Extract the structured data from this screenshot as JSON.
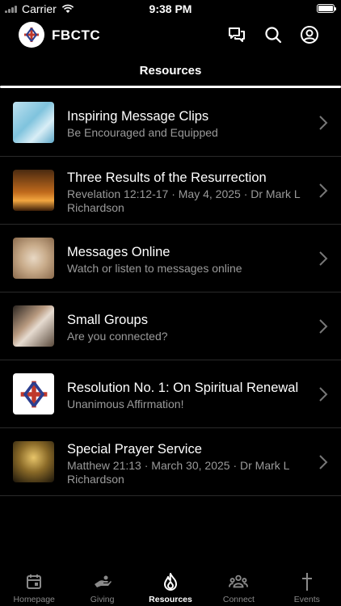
{
  "status_bar": {
    "carrier": "Carrier",
    "time": "9:38 PM"
  },
  "header": {
    "org_name": "FBCTC"
  },
  "section": {
    "title": "Resources"
  },
  "resources": [
    {
      "title": "Inspiring Message Clips",
      "subtitle": "Be Encouraged and Equipped",
      "thumb": "sky"
    },
    {
      "title": "Three Results of the Resurrection",
      "subtitle": "Revelation 12:12-17 · May 4, 2025 · Dr Mark L Richardson",
      "thumb": "resurrection"
    },
    {
      "title": "Messages Online",
      "subtitle": "Watch or listen to messages online",
      "thumb": "online"
    },
    {
      "title": "Small Groups",
      "subtitle": "Are you connected?",
      "thumb": "groups"
    },
    {
      "title": "Resolution No. 1: On Spiritual Renewal",
      "subtitle": "Unanimous Affirmation!",
      "thumb": "logo"
    },
    {
      "title": "Special Prayer Service",
      "subtitle": "Matthew 21:13 · March 30, 2025 · Dr Mark L Richardson",
      "thumb": "prayer"
    }
  ],
  "nav": [
    {
      "label": "Homepage",
      "icon": "calendar-icon"
    },
    {
      "label": "Giving",
      "icon": "giving-hand-icon"
    },
    {
      "label": "Resources",
      "icon": "flame-icon",
      "active": true
    },
    {
      "label": "Connect",
      "icon": "people-icon"
    },
    {
      "label": "Events",
      "icon": "cross-icon"
    }
  ],
  "colors": {
    "background": "#000000",
    "text_secondary": "#9a9a9a",
    "nav_inactive": "#8a8a8a"
  }
}
